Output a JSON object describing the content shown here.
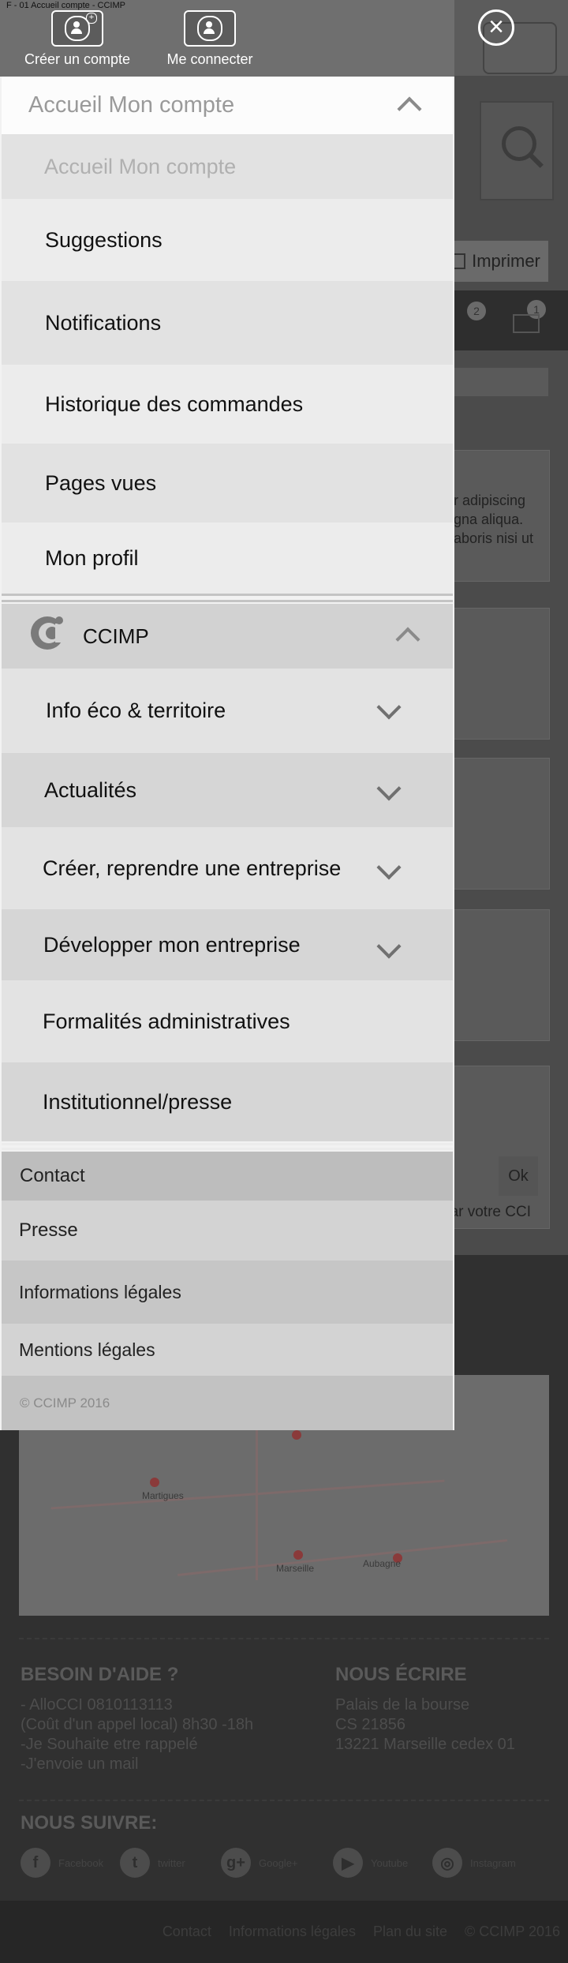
{
  "window_title": "F - 01 Accueil compte - CCIMP",
  "top_actions": {
    "create_account": "Créer un compte",
    "login": "Me connecter"
  },
  "account_section": {
    "header": "Accueil Mon compte",
    "items": [
      "Accueil Mon compte",
      "Suggestions",
      "Notifications",
      "Historique des commandes",
      "Pages vues",
      "Mon profil"
    ]
  },
  "ccimp_section": {
    "header": "CCIMP",
    "items": [
      {
        "label": "Info éco & territoire",
        "expandable": true
      },
      {
        "label": "Actualités",
        "expandable": true
      },
      {
        "label": "Créer, reprendre une entreprise",
        "expandable": true
      },
      {
        "label": "Développer mon entreprise",
        "expandable": true
      },
      {
        "label": "Formalités administratives",
        "expandable": false
      },
      {
        "label": "Institutionnel/presse",
        "expandable": false
      }
    ]
  },
  "footer_links": {
    "contact": "Contact",
    "presse": "Presse",
    "infos": "Informations légales",
    "mentions": "Mentions légales"
  },
  "copyright": "© CCIMP 2016",
  "background": {
    "print_button": "Imprimer",
    "badge_notifications": "2",
    "badge_messages": "1",
    "text_lines": [
      "r adipiscing",
      "gna aliqua.",
      "aboris nisi ut"
    ],
    "ok_button": "Ok",
    "cci_text": "par votre CCI",
    "map_labels": [
      "Marseille",
      "Martigues",
      "Aubagne"
    ],
    "help": {
      "title": "BESOIN D'AIDE ?",
      "lines": [
        "- AlloCCI 0810113113",
        "(Coût d'un appel local) 8h30 -18h",
        "-Je Souhaite etre rappelé",
        "-J'envoie un mail"
      ]
    },
    "write": {
      "title": "NOUS ÉCRIRE",
      "lines": [
        "Palais de la bourse",
        "CS 21856",
        "13221 Marseille cedex 01"
      ]
    },
    "follow": {
      "title": "NOUS SUIVRE:",
      "networks": [
        {
          "icon": "f",
          "label": "Facebook"
        },
        {
          "icon": "t",
          "label": "twitter"
        },
        {
          "icon": "g+",
          "label": "Google+"
        },
        {
          "icon": "▶",
          "label": "Youtube"
        },
        {
          "icon": "◎",
          "label": "Instagram"
        }
      ]
    },
    "bottom_links": [
      "Contact",
      "Informations légales",
      "Plan du site",
      "© CCIMP 2016"
    ]
  }
}
